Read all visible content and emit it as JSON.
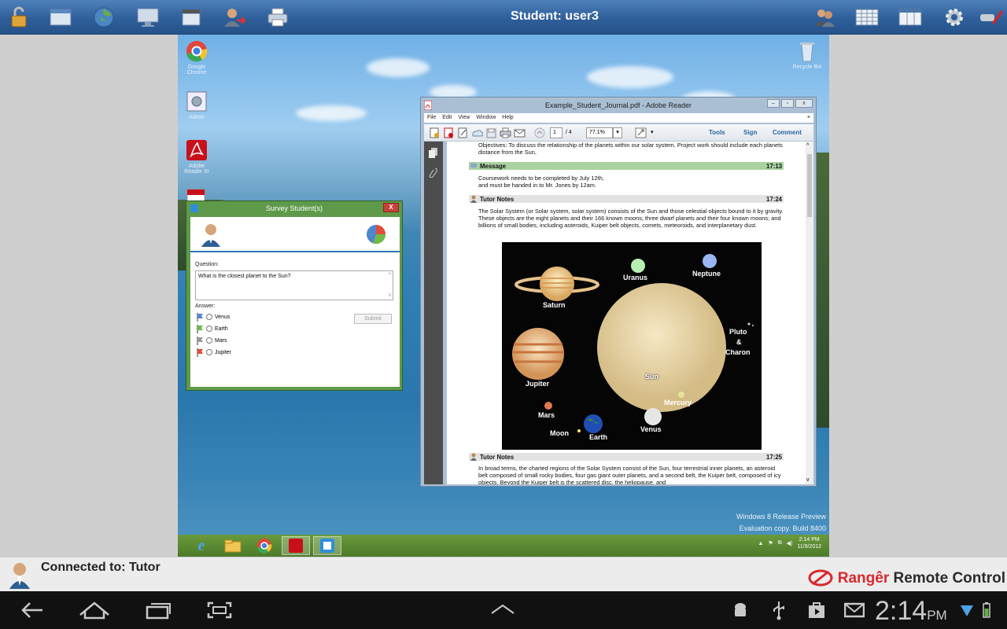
{
  "topbar": {
    "title": "Student: user3"
  },
  "desktop": {
    "icons": [
      {
        "label": "Google Chrome"
      },
      {
        "label": "Admin"
      },
      {
        "label": "Adobe Reader XI"
      },
      {
        "label": "Recycle Bin"
      }
    ],
    "watermark": {
      "line1": "Windows 8 Release Preview",
      "line2": "Evaluation copy. Build 8400"
    },
    "clock": {
      "time": "2:14 PM",
      "date": "11/9/2012"
    }
  },
  "survey": {
    "title": "Survey Student(s)",
    "close_label": "X",
    "question_label": "Question:",
    "question": "What is the closest planet to the Sun?",
    "answer_label": "Answer:",
    "answers": [
      "Venus",
      "Earth",
      "Mars",
      "Jupiter"
    ],
    "submit_label": "Submit"
  },
  "reader": {
    "title": "Example_Student_Journal.pdf - Adobe Reader",
    "menu": [
      "File",
      "Edit",
      "View",
      "Window",
      "Help"
    ],
    "page_current": "1",
    "page_total": "/ 4",
    "zoom": "77.1%",
    "tools": "Tools",
    "sign": "Sign",
    "comment": "Comment",
    "content": {
      "intro": "Objectives: To discuss the relationship of the planets within our solar system. Project work should include each planets distance from the Sun,",
      "message": {
        "title": "Message",
        "time": "17:13",
        "text1": "Coursework needs to be completed by July 12th,",
        "text2": "and must be handed in to Mr. Jones by 12am."
      },
      "tutor1": {
        "title": "Tutor Notes",
        "time": "17:24",
        "text": "The Solar System (or Solar system, solar system) consists of the Sun and those celestial objects bound to it by gravity. These objects are the eight planets and their 166 known moons; three dwarf planets and their four known moons; and billions of small bodies, including asteroids, Kuiper belt objects, comets, meteoroids, and interplanetary dust."
      },
      "planets": {
        "saturn": "Saturn",
        "uranus": "Uranus",
        "neptune": "Neptune",
        "jupiter": "Jupiter",
        "sun": "Sun",
        "pluto": "Pluto",
        "amp": "&",
        "charon": "Charon",
        "mercury": "Mercury",
        "mars": "Mars",
        "moon": "Moon",
        "earth": "Earth",
        "venus": "Venus"
      },
      "tutor2": {
        "title": "Tutor Notes",
        "time": "17:25",
        "text": "In broad terms, the charted regions of the Solar System consist of the Sun, four terrestrial inner planets, an asteroid belt composed of small rocky bodies, four gas giant outer planets, and a second belt, the Kuiper belt, composed of icy objects. Beyond the Kuiper belt is the scattered disc, the heliopause, and"
      }
    }
  },
  "connection": {
    "text": "Connected to: Tutor"
  },
  "brand": {
    "part1": "Rangêr",
    "part2": "Remote Control"
  },
  "android": {
    "time": "2:14",
    "ampm": "PM"
  }
}
